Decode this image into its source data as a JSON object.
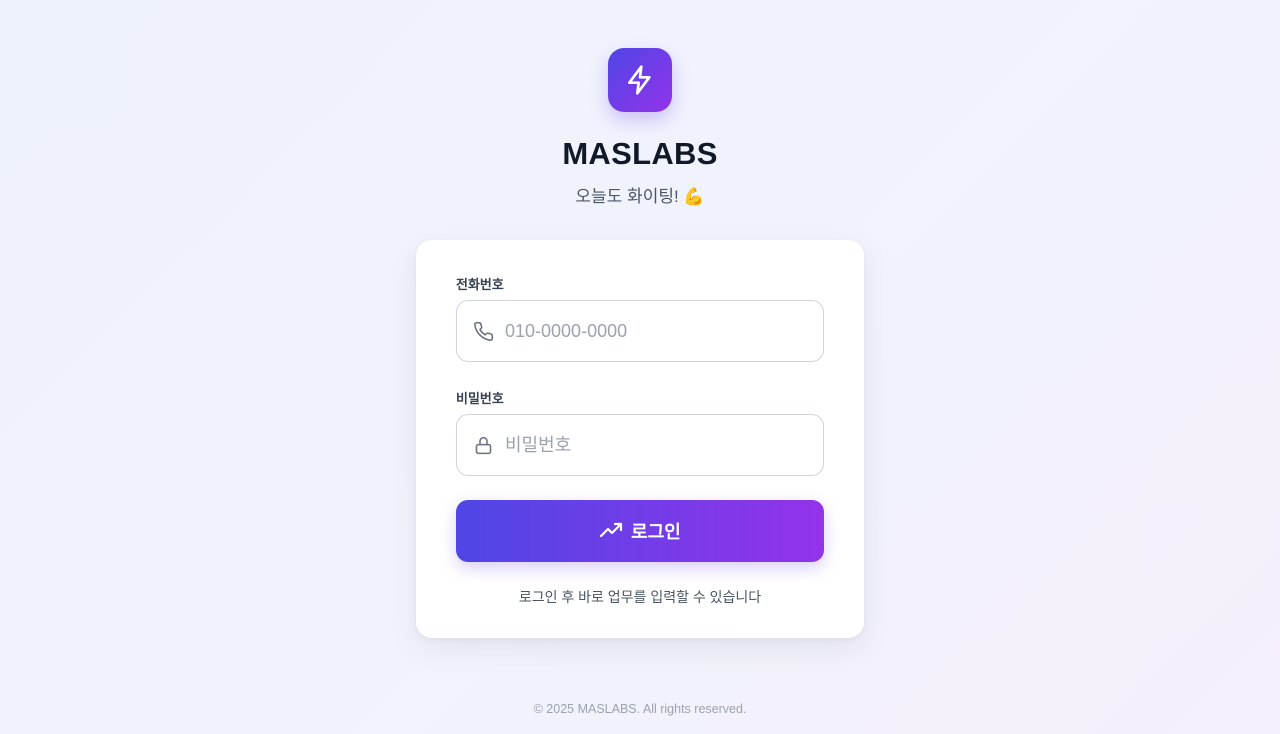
{
  "brand": {
    "logo_icon": "lightning-bolt-icon",
    "title": "MASLABS",
    "subtitle": "오늘도 화이팅! 💪"
  },
  "form": {
    "phone": {
      "label": "전화번호",
      "placeholder": "010-0000-0000",
      "value": "",
      "icon": "phone-icon"
    },
    "password": {
      "label": "비밀번호",
      "placeholder": "비밀번호",
      "value": "",
      "icon": "lock-icon"
    },
    "submit": {
      "label": "로그인",
      "icon": "trending-up-icon"
    },
    "hint": "로그인 후 바로 업무를 입력할 수 있습니다"
  },
  "footer": {
    "copyright": "© 2025 MASLABS. All rights reserved."
  },
  "colors": {
    "accent_start": "#4f46e5",
    "accent_end": "#9333ea",
    "background": "#eef2fd",
    "card": "#ffffff"
  }
}
